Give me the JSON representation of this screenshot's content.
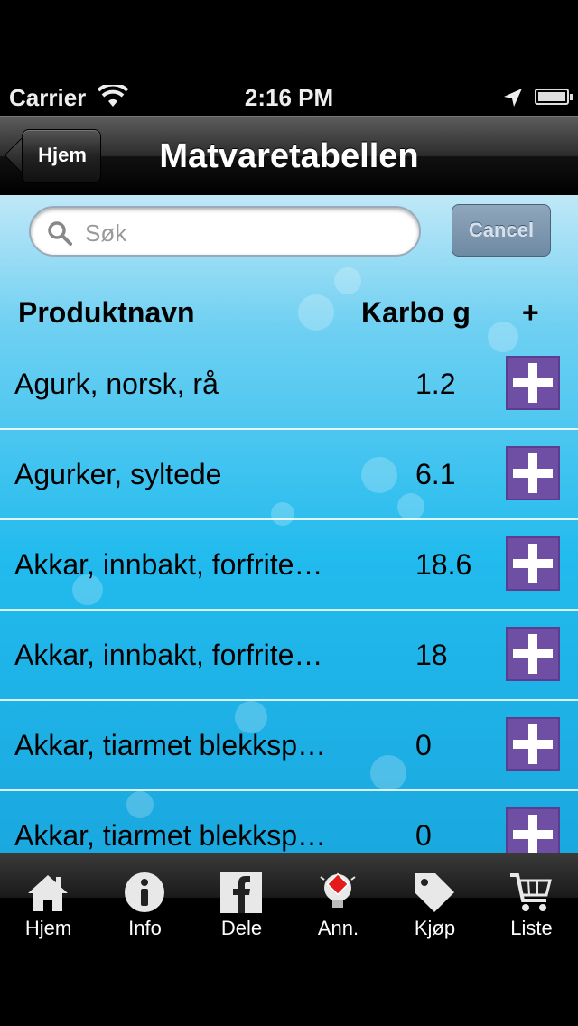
{
  "status_bar": {
    "carrier": "Carrier",
    "time": "2:16 PM"
  },
  "nav": {
    "back_label": "Hjem",
    "title": "Matvaretabellen"
  },
  "search": {
    "placeholder": "Søk",
    "value": "",
    "cancel_label": "Cancel"
  },
  "table": {
    "headers": {
      "name": "Produktnavn",
      "karbo": "Karbo g",
      "add": "+"
    },
    "rows": [
      {
        "name": "Agurk, norsk, rå",
        "karbo": "1.2"
      },
      {
        "name": "Agurker, syltede",
        "karbo": "6.1"
      },
      {
        "name": "Akkar, innbakt, forfrite…",
        "karbo": "18.6"
      },
      {
        "name": "Akkar, innbakt, forfrite…",
        "karbo": "18"
      },
      {
        "name": "Akkar, tiarmet blekksp…",
        "karbo": "0"
      },
      {
        "name": "Akkar, tiarmet blekksp…",
        "karbo": "0"
      }
    ]
  },
  "tabs": [
    {
      "label": "Hjem",
      "icon": "home-icon"
    },
    {
      "label": "Info",
      "icon": "info-icon"
    },
    {
      "label": "Dele",
      "icon": "facebook-icon"
    },
    {
      "label": "Ann.",
      "icon": "ad-icon"
    },
    {
      "label": "Kjøp",
      "icon": "tag-icon"
    },
    {
      "label": "Liste",
      "icon": "cart-icon"
    }
  ]
}
